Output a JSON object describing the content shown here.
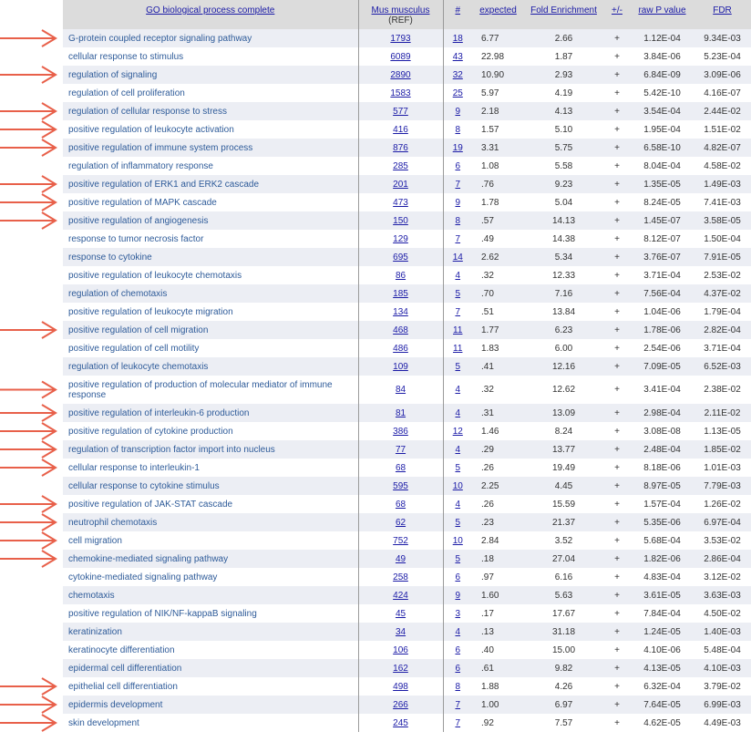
{
  "headers": {
    "term": "GO biological process complete",
    "ref": "Mus musculus",
    "ref_sub": "(REF)",
    "num": "#",
    "expected": "expected",
    "fold": "Fold Enrichment",
    "dir": "+/-",
    "p": "raw P value",
    "fdr": "FDR"
  },
  "arrow_color": "#e8604a",
  "rows": [
    {
      "term": "G-protein coupled receptor signaling pathway",
      "ref": "1793",
      "num": "18",
      "expected": "6.77",
      "fold": "2.66",
      "dir": "+",
      "p": "1.12E-04",
      "fdr": "9.34E-03",
      "arrow": true
    },
    {
      "term": "cellular response to stimulus",
      "ref": "6089",
      "num": "43",
      "expected": "22.98",
      "fold": "1.87",
      "dir": "+",
      "p": "3.84E-06",
      "fdr": "5.23E-04",
      "arrow": false
    },
    {
      "term": "regulation of signaling",
      "ref": "2890",
      "num": "32",
      "expected": "10.90",
      "fold": "2.93",
      "dir": "+",
      "p": "6.84E-09",
      "fdr": "3.09E-06",
      "arrow": true
    },
    {
      "term": "regulation of cell proliferation",
      "ref": "1583",
      "num": "25",
      "expected": "5.97",
      "fold": "4.19",
      "dir": "+",
      "p": "5.42E-10",
      "fdr": "4.16E-07",
      "arrow": false
    },
    {
      "term": "regulation of cellular response to stress",
      "ref": "577",
      "num": "9",
      "expected": "2.18",
      "fold": "4.13",
      "dir": "+",
      "p": "3.54E-04",
      "fdr": "2.44E-02",
      "arrow": true
    },
    {
      "term": "positive regulation of leukocyte activation",
      "ref": "416",
      "num": "8",
      "expected": "1.57",
      "fold": "5.10",
      "dir": "+",
      "p": "1.95E-04",
      "fdr": "1.51E-02",
      "arrow": true
    },
    {
      "term": "positive regulation of immune system process",
      "ref": "876",
      "num": "19",
      "expected": "3.31",
      "fold": "5.75",
      "dir": "+",
      "p": "6.58E-10",
      "fdr": "4.82E-07",
      "arrow": true
    },
    {
      "term": "regulation of inflammatory response",
      "ref": "285",
      "num": "6",
      "expected": "1.08",
      "fold": "5.58",
      "dir": "+",
      "p": "8.04E-04",
      "fdr": "4.58E-02",
      "arrow": false
    },
    {
      "term": "positive regulation of ERK1 and ERK2 cascade",
      "ref": "201",
      "num": "7",
      "expected": ".76",
      "fold": "9.23",
      "dir": "+",
      "p": "1.35E-05",
      "fdr": "1.49E-03",
      "arrow": true
    },
    {
      "term": "positive regulation of MAPK cascade",
      "ref": "473",
      "num": "9",
      "expected": "1.78",
      "fold": "5.04",
      "dir": "+",
      "p": "8.24E-05",
      "fdr": "7.41E-03",
      "arrow": true
    },
    {
      "term": "positive regulation of angiogenesis",
      "ref": "150",
      "num": "8",
      "expected": ".57",
      "fold": "14.13",
      "dir": "+",
      "p": "1.45E-07",
      "fdr": "3.58E-05",
      "arrow": true
    },
    {
      "term": "response to tumor necrosis factor",
      "ref": "129",
      "num": "7",
      "expected": ".49",
      "fold": "14.38",
      "dir": "+",
      "p": "8.12E-07",
      "fdr": "1.50E-04",
      "arrow": false
    },
    {
      "term": "response to cytokine",
      "ref": "695",
      "num": "14",
      "expected": "2.62",
      "fold": "5.34",
      "dir": "+",
      "p": "3.76E-07",
      "fdr": "7.91E-05",
      "arrow": false
    },
    {
      "term": "positive regulation of leukocyte chemotaxis",
      "ref": "86",
      "num": "4",
      "expected": ".32",
      "fold": "12.33",
      "dir": "+",
      "p": "3.71E-04",
      "fdr": "2.53E-02",
      "arrow": false
    },
    {
      "term": "regulation of chemotaxis",
      "ref": "185",
      "num": "5",
      "expected": ".70",
      "fold": "7.16",
      "dir": "+",
      "p": "7.56E-04",
      "fdr": "4.37E-02",
      "arrow": false
    },
    {
      "term": "positive regulation of leukocyte migration",
      "ref": "134",
      "num": "7",
      "expected": ".51",
      "fold": "13.84",
      "dir": "+",
      "p": "1.04E-06",
      "fdr": "1.79E-04",
      "arrow": false
    },
    {
      "term": "positive regulation of cell migration",
      "ref": "468",
      "num": "11",
      "expected": "1.77",
      "fold": "6.23",
      "dir": "+",
      "p": "1.78E-06",
      "fdr": "2.82E-04",
      "arrow": true
    },
    {
      "term": "positive regulation of cell motility",
      "ref": "486",
      "num": "11",
      "expected": "1.83",
      "fold": "6.00",
      "dir": "+",
      "p": "2.54E-06",
      "fdr": "3.71E-04",
      "arrow": false
    },
    {
      "term": "regulation of leukocyte chemotaxis",
      "ref": "109",
      "num": "5",
      "expected": ".41",
      "fold": "12.16",
      "dir": "+",
      "p": "7.09E-05",
      "fdr": "6.52E-03",
      "arrow": false
    },
    {
      "term": "positive regulation of production of molecular mediator of immune response",
      "ref": "84",
      "num": "4",
      "expected": ".32",
      "fold": "12.62",
      "dir": "+",
      "p": "3.41E-04",
      "fdr": "2.38E-02",
      "arrow": true,
      "tall": true
    },
    {
      "term": "positive regulation of interleukin-6 production",
      "ref": "81",
      "num": "4",
      "expected": ".31",
      "fold": "13.09",
      "dir": "+",
      "p": "2.98E-04",
      "fdr": "2.11E-02",
      "arrow": true
    },
    {
      "term": "positive regulation of cytokine production",
      "ref": "386",
      "num": "12",
      "expected": "1.46",
      "fold": "8.24",
      "dir": "+",
      "p": "3.08E-08",
      "fdr": "1.13E-05",
      "arrow": true
    },
    {
      "term": "regulation of transcription factor import into nucleus",
      "ref": "77",
      "num": "4",
      "expected": ".29",
      "fold": "13.77",
      "dir": "+",
      "p": "2.48E-04",
      "fdr": "1.85E-02",
      "arrow": true
    },
    {
      "term": "cellular response to interleukin-1",
      "ref": "68",
      "num": "5",
      "expected": ".26",
      "fold": "19.49",
      "dir": "+",
      "p": "8.18E-06",
      "fdr": "1.01E-03",
      "arrow": true
    },
    {
      "term": "cellular response to cytokine stimulus",
      "ref": "595",
      "num": "10",
      "expected": "2.25",
      "fold": "4.45",
      "dir": "+",
      "p": "8.97E-05",
      "fdr": "7.79E-03",
      "arrow": false
    },
    {
      "term": "positive regulation of JAK-STAT cascade",
      "ref": "68",
      "num": "4",
      "expected": ".26",
      "fold": "15.59",
      "dir": "+",
      "p": "1.57E-04",
      "fdr": "1.26E-02",
      "arrow": true
    },
    {
      "term": "neutrophil chemotaxis",
      "ref": "62",
      "num": "5",
      "expected": ".23",
      "fold": "21.37",
      "dir": "+",
      "p": "5.35E-06",
      "fdr": "6.97E-04",
      "arrow": true
    },
    {
      "term": "cell migration",
      "ref": "752",
      "num": "10",
      "expected": "2.84",
      "fold": "3.52",
      "dir": "+",
      "p": "5.68E-04",
      "fdr": "3.53E-02",
      "arrow": true
    },
    {
      "term": "chemokine-mediated signaling pathway",
      "ref": "49",
      "num": "5",
      "expected": ".18",
      "fold": "27.04",
      "dir": "+",
      "p": "1.82E-06",
      "fdr": "2.86E-04",
      "arrow": true
    },
    {
      "term": "cytokine-mediated signaling pathway",
      "ref": "258",
      "num": "6",
      "expected": ".97",
      "fold": "6.16",
      "dir": "+",
      "p": "4.83E-04",
      "fdr": "3.12E-02",
      "arrow": false
    },
    {
      "term": "chemotaxis",
      "ref": "424",
      "num": "9",
      "expected": "1.60",
      "fold": "5.63",
      "dir": "+",
      "p": "3.61E-05",
      "fdr": "3.63E-03",
      "arrow": false
    },
    {
      "term": "positive regulation of NIK/NF-kappaB signaling",
      "ref": "45",
      "num": "3",
      "expected": ".17",
      "fold": "17.67",
      "dir": "+",
      "p": "7.84E-04",
      "fdr": "4.50E-02",
      "arrow": false
    },
    {
      "term": "keratinization",
      "ref": "34",
      "num": "4",
      "expected": ".13",
      "fold": "31.18",
      "dir": "+",
      "p": "1.24E-05",
      "fdr": "1.40E-03",
      "arrow": false
    },
    {
      "term": "keratinocyte differentiation",
      "ref": "106",
      "num": "6",
      "expected": ".40",
      "fold": "15.00",
      "dir": "+",
      "p": "4.10E-06",
      "fdr": "5.48E-04",
      "arrow": false
    },
    {
      "term": "epidermal cell differentiation",
      "ref": "162",
      "num": "6",
      "expected": ".61",
      "fold": "9.82",
      "dir": "+",
      "p": "4.13E-05",
      "fdr": "4.10E-03",
      "arrow": false
    },
    {
      "term": "epithelial cell differentiation",
      "ref": "498",
      "num": "8",
      "expected": "1.88",
      "fold": "4.26",
      "dir": "+",
      "p": "6.32E-04",
      "fdr": "3.79E-02",
      "arrow": true
    },
    {
      "term": "epidermis development",
      "ref": "266",
      "num": "7",
      "expected": "1.00",
      "fold": "6.97",
      "dir": "+",
      "p": "7.64E-05",
      "fdr": "6.99E-03",
      "arrow": true
    },
    {
      "term": "skin development",
      "ref": "245",
      "num": "7",
      "expected": ".92",
      "fold": "7.57",
      "dir": "+",
      "p": "4.62E-05",
      "fdr": "4.49E-03",
      "arrow": true
    }
  ]
}
